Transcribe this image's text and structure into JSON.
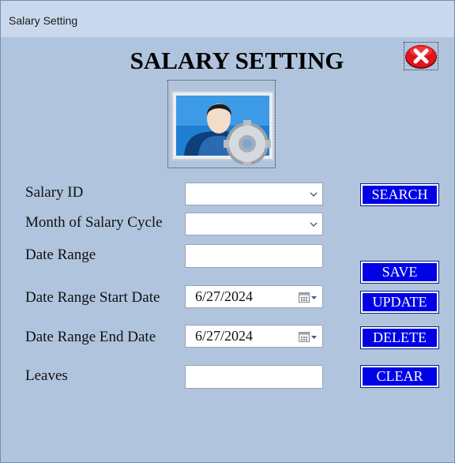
{
  "window": {
    "title": "Salary Setting"
  },
  "form": {
    "heading": "SALARY SETTING",
    "labels": {
      "salary_id": "Salary ID",
      "month_cycle": "Month of Salary Cycle",
      "date_range": "Date Range",
      "start_date": "Date Range Start Date",
      "end_date": "Date Range End Date",
      "leaves": "Leaves"
    },
    "values": {
      "salary_id": "",
      "month_cycle": "",
      "date_range": "",
      "start_date": "6/27/2024",
      "end_date": "6/27/2024",
      "leaves": ""
    }
  },
  "buttons": {
    "search": "SEARCH",
    "save": "SAVE",
    "update": "UPDATE",
    "delete": "DELETE",
    "clear": "CLEAR"
  },
  "icons": {
    "close": "close-icon",
    "user_settings": "user-settings-icon",
    "dropdown": "chevron-down-icon",
    "calendar": "calendar-icon"
  },
  "colors": {
    "background": "#b0c4de",
    "button": "#0000e6",
    "close_button": "#e0141b"
  }
}
